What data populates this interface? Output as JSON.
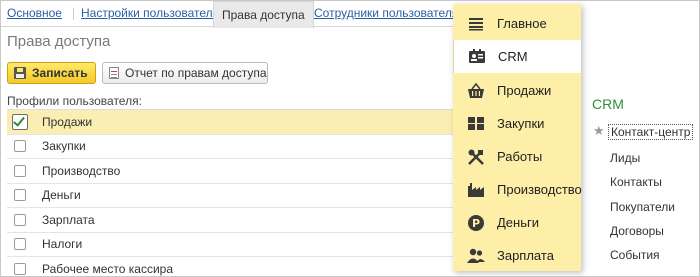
{
  "tabs": [
    {
      "label": "Основное"
    },
    {
      "label": "Настройки пользователя"
    },
    {
      "label": "Права доступа"
    },
    {
      "label": "Сотрудники пользователя"
    }
  ],
  "page_title": "Права доступа",
  "toolbar": {
    "save_label": "Записать",
    "report_label": "Отчет по правам доступа"
  },
  "profiles_label": "Профили пользователя:",
  "profiles": [
    {
      "label": "Продажи",
      "checked": true
    },
    {
      "label": "Закупки",
      "checked": false
    },
    {
      "label": "Производство",
      "checked": false
    },
    {
      "label": "Деньги",
      "checked": false
    },
    {
      "label": "Зарплата",
      "checked": false
    },
    {
      "label": "Налоги",
      "checked": false
    },
    {
      "label": "Рабочее место кассира",
      "checked": false
    }
  ],
  "menu": {
    "items": [
      {
        "label": "Главное",
        "icon": "list-icon"
      },
      {
        "label": "CRM",
        "icon": "contacts-card-icon"
      },
      {
        "label": "Продажи",
        "icon": "basket-icon"
      },
      {
        "label": "Закупки",
        "icon": "pallet-icon"
      },
      {
        "label": "Работы",
        "icon": "tools-icon"
      },
      {
        "label": "Производство",
        "icon": "factory-icon"
      },
      {
        "label": "Деньги",
        "icon": "coin-icon"
      },
      {
        "label": "Зарплата",
        "icon": "people-icon"
      }
    ],
    "active": "CRM"
  },
  "crm_panel": {
    "title": "CRM",
    "items": [
      {
        "label": "Контакт-центр"
      },
      {
        "label": "Лиды"
      },
      {
        "label": "Контакты"
      },
      {
        "label": "Покупатели"
      },
      {
        "label": "Договоры"
      },
      {
        "label": "События"
      }
    ]
  },
  "colors": {
    "accent_yellow": "#fdeea8",
    "selected_row": "#fbeeb2",
    "link_blue": "#2b5fa3",
    "crm_green": "#2f8f3a"
  }
}
